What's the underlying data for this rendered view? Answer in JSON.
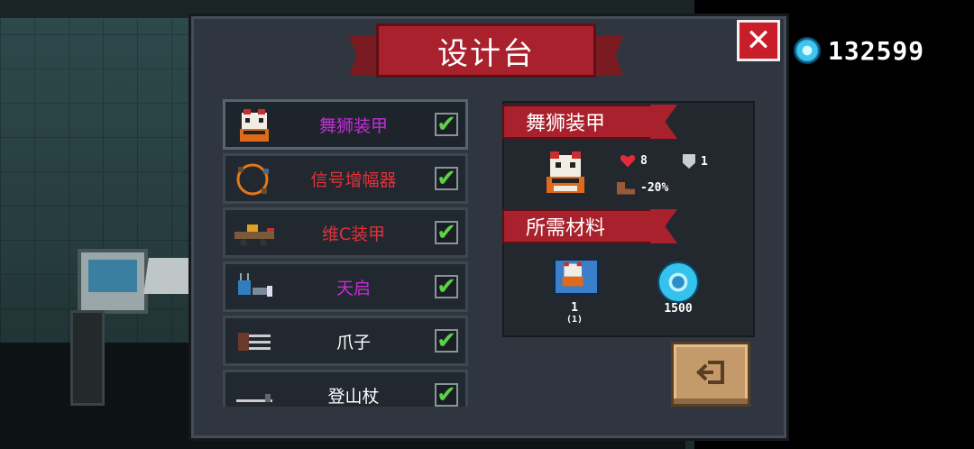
{
  "title": "设计台",
  "close_label": "✕",
  "currency": {
    "icon": "gem-icon",
    "amount": "132599"
  },
  "items": [
    {
      "name": "舞狮装甲",
      "color": "#c22dd6",
      "checked": true,
      "selected": true
    },
    {
      "name": "信号增幅器",
      "color": "#e0323a",
      "checked": true,
      "selected": false
    },
    {
      "name": "维C装甲",
      "color": "#e0323a",
      "checked": true,
      "selected": false
    },
    {
      "name": "天启",
      "color": "#c22dd6",
      "checked": true,
      "selected": false
    },
    {
      "name": "爪子",
      "color": "#ffffff",
      "checked": true,
      "selected": false
    },
    {
      "name": "登山杖",
      "color": "#ffffff",
      "checked": true,
      "selected": false
    }
  ],
  "check_mark": "✔",
  "detail": {
    "item_name": "舞狮装甲",
    "health": "8",
    "armor": "1",
    "speed": "-20%",
    "materials_title": "所需材料",
    "materials": [
      {
        "icon": "lion-blueprint-icon",
        "quantity": "1",
        "owned": "(1)"
      },
      {
        "icon": "gem-icon",
        "quantity": "1500"
      }
    ]
  },
  "exit_icon": "exit-door-icon"
}
